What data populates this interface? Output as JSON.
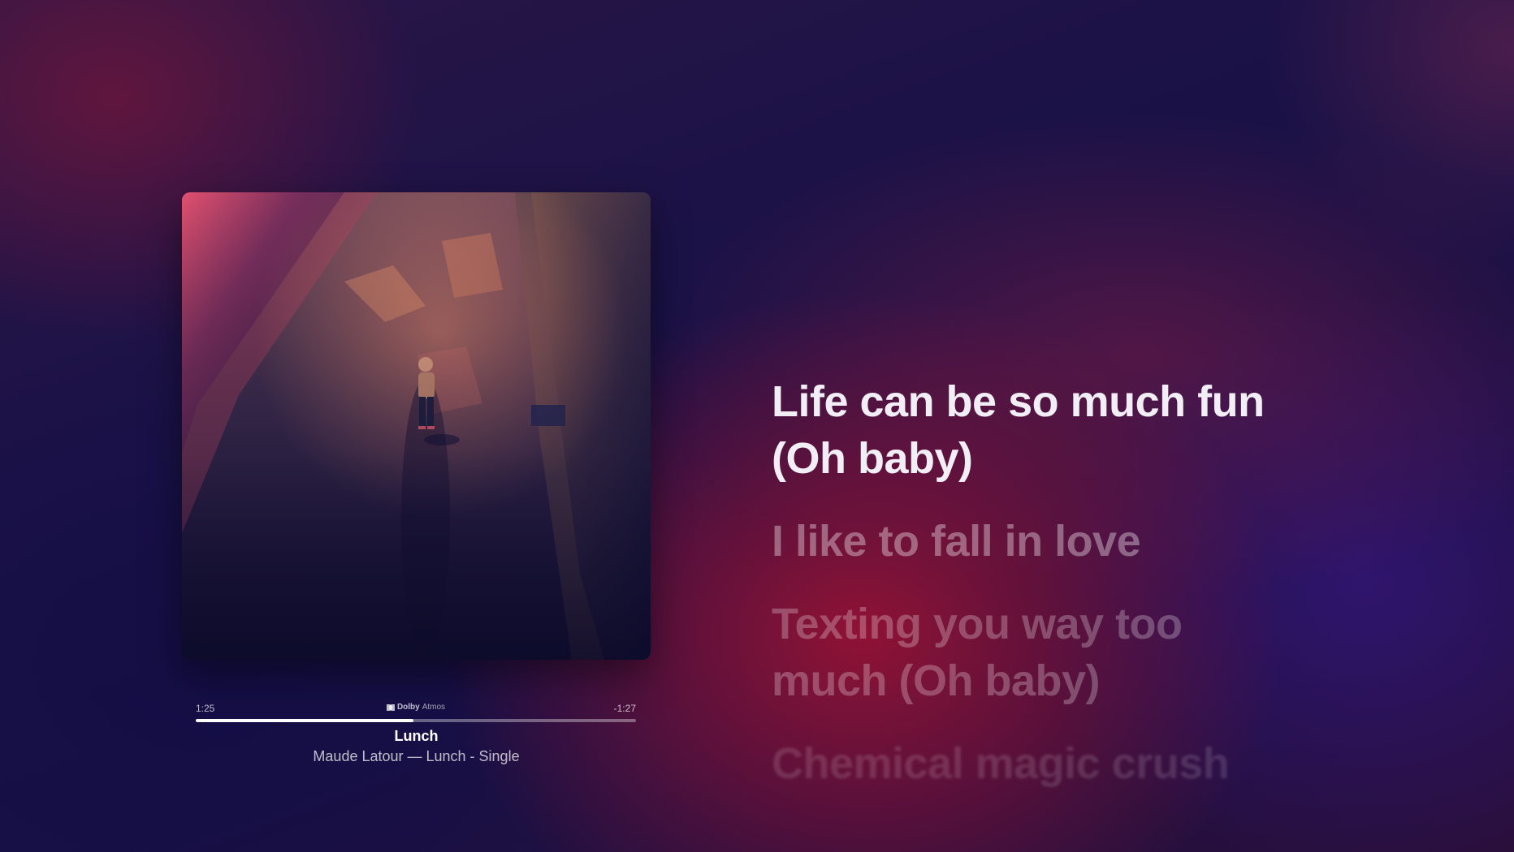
{
  "now_playing": {
    "elapsed": "1:25",
    "remaining": "-1:27",
    "progress": 0.495,
    "audio_format": {
      "brand": "Dolby",
      "label": "Atmos",
      "icon": "dolby-logo-icon"
    },
    "title": "Lunch",
    "subtitle": "Maude Latour — Lunch - Single"
  },
  "lyrics": {
    "current": [
      "Life can be so much fun",
      "(Oh baby)"
    ],
    "upcoming": [
      [
        "I like to fall in love"
      ],
      [
        "Texting you way too",
        "much (Oh baby)"
      ],
      [
        "Chemical magic crush"
      ]
    ]
  },
  "colors": {
    "background_base": "#1a1240",
    "accent_red": "#96123a",
    "text_primary": "#ffffff"
  }
}
